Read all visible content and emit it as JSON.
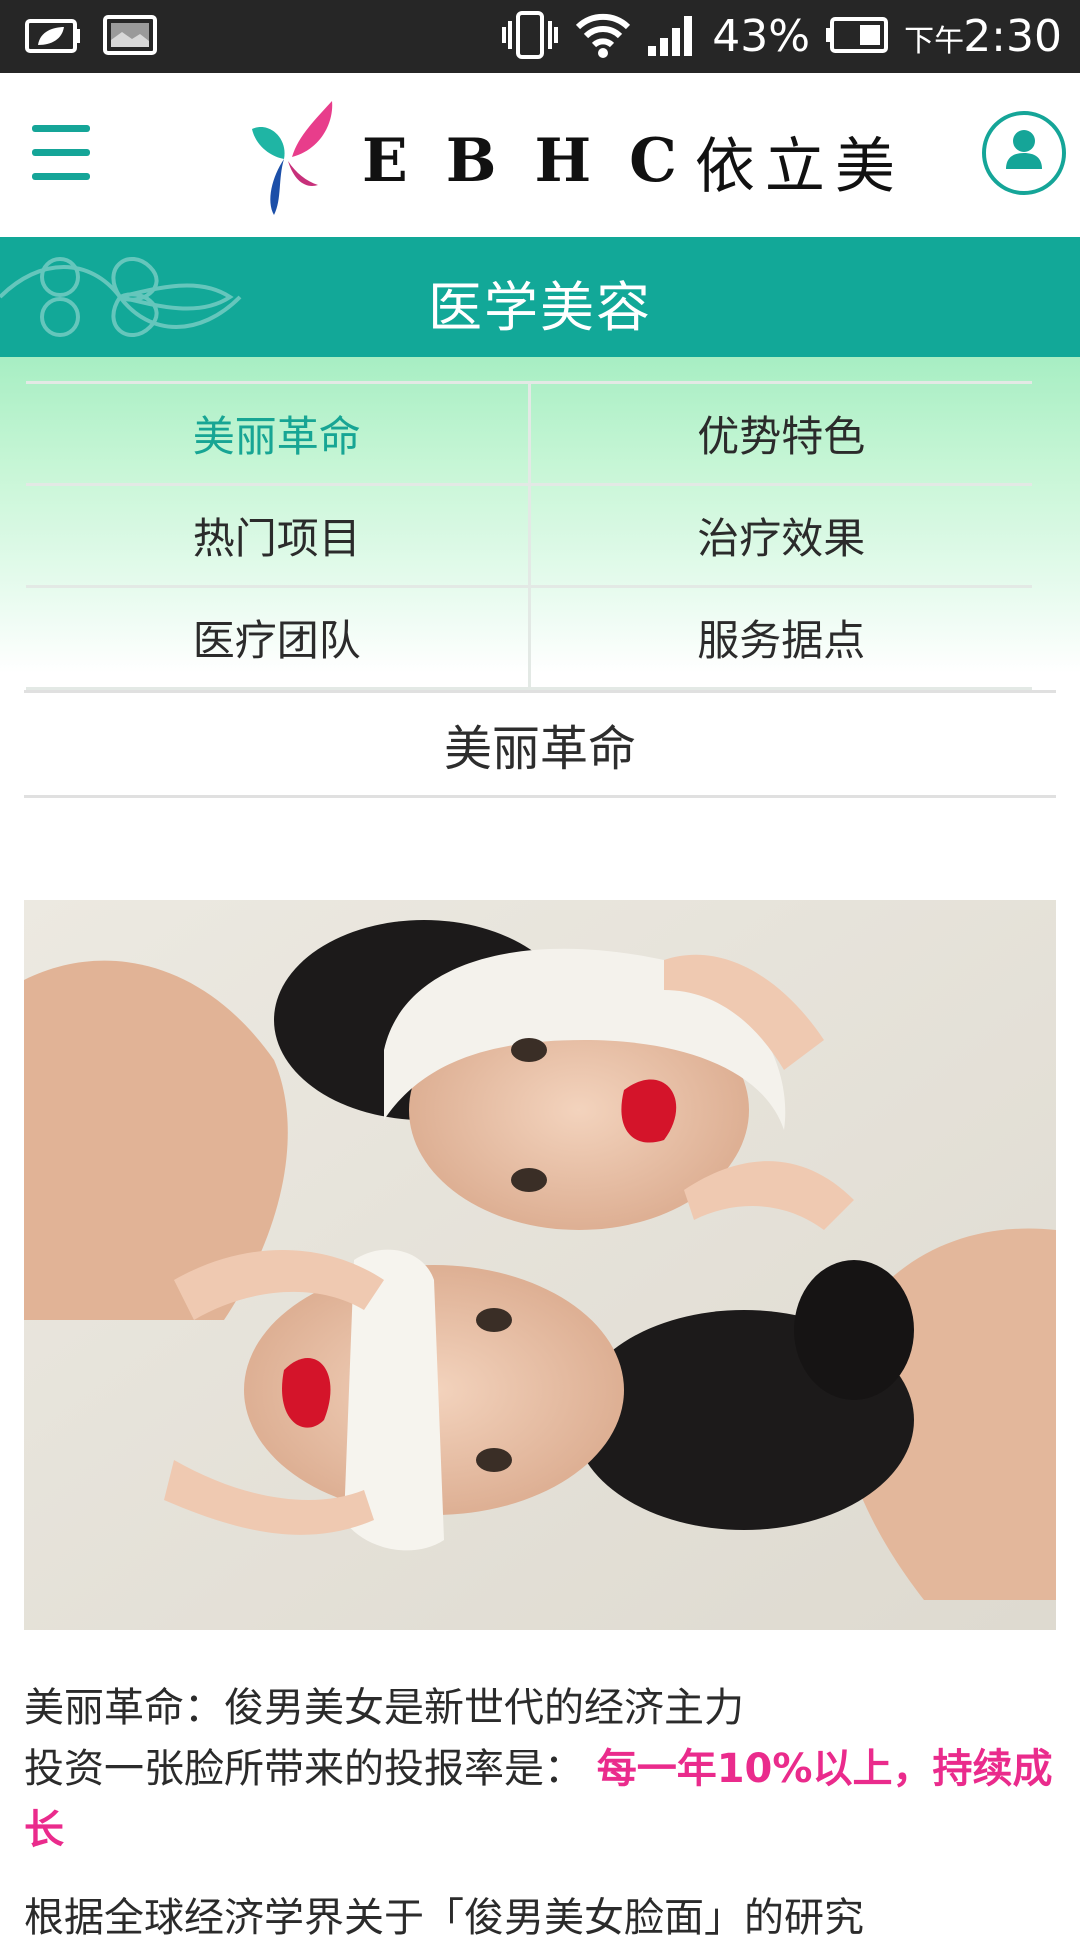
{
  "status_bar": {
    "battery_percent": "43%",
    "time_prefix": "下午",
    "time": "2:30",
    "icons": [
      "leaf-battery-icon",
      "image-icon",
      "vibrate-icon",
      "wifi-icon",
      "signal-icon",
      "battery-icon"
    ]
  },
  "header": {
    "brand_latin": "EBHC",
    "brand_chinese": "依立美",
    "menu_icon": "hamburger-icon",
    "user_icon": "user-icon"
  },
  "band": {
    "title": "医学美容"
  },
  "submenu": {
    "items": [
      {
        "label": "美丽革命",
        "active": true
      },
      {
        "label": "优势特色",
        "active": false
      },
      {
        "label": "热门项目",
        "active": false
      },
      {
        "label": "治疗效果",
        "active": false
      },
      {
        "label": "医疗团队",
        "active": false
      },
      {
        "label": "服务据点",
        "active": false
      }
    ]
  },
  "section": {
    "title": "美丽革命"
  },
  "article": {
    "line1": "美丽革命：俊男美女是新世代的经济主力",
    "line2_prefix": "投资一张脸所带来的投报率是：",
    "line2_highlight": "每一年10%以上，持续成长",
    "line3_partial": "根据全球经济学界关于「俊男美女脸面」的研究"
  },
  "colors": {
    "accent": "#15a598",
    "highlight": "#ea2b8c",
    "status_bar": "#262626"
  }
}
